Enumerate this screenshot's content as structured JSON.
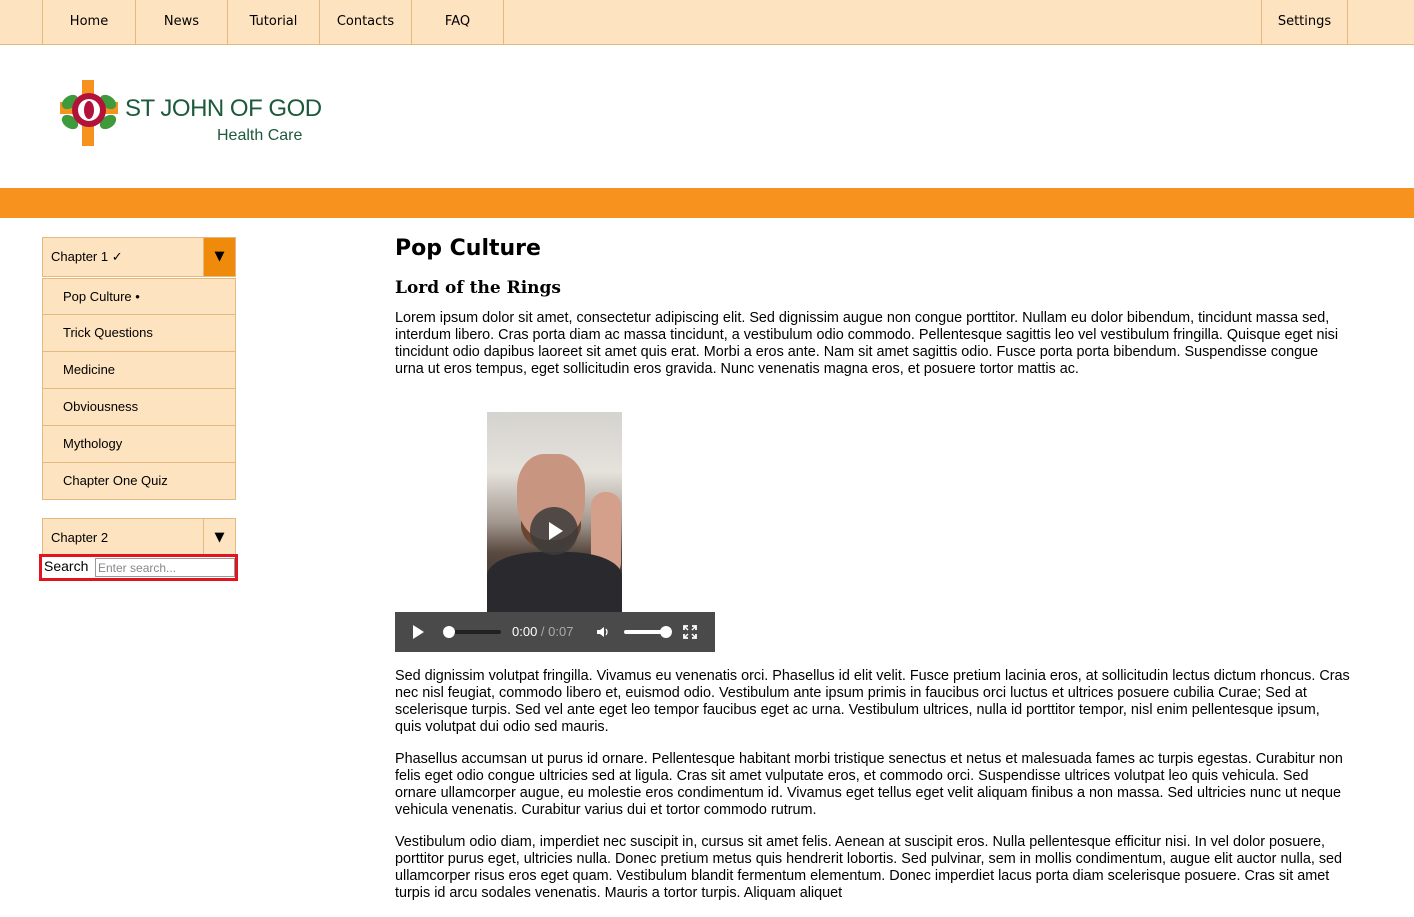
{
  "nav": {
    "home": "Home",
    "news": "News",
    "tutorial": "Tutorial",
    "contacts": "Contacts",
    "faq": "FAQ",
    "settings": "Settings"
  },
  "logo": {
    "line1": "ST JOHN OF GOD",
    "line2": "Health Care"
  },
  "colors": {
    "nav_bg": "#fde3bf",
    "accent_orange": "#f7921e",
    "toggle_active": "#f08a0b",
    "search_highlight": "#e0151f"
  },
  "sidebar": {
    "chapter1": {
      "label": "Chapter 1 ✓",
      "toggle": "▼"
    },
    "items": [
      {
        "label": "Pop Culture •"
      },
      {
        "label": "Trick Questions"
      },
      {
        "label": "Medicine"
      },
      {
        "label": "Obviousness"
      },
      {
        "label": "Mythology"
      },
      {
        "label": "Chapter One Quiz"
      }
    ],
    "chapter2": {
      "label": "Chapter 2",
      "toggle": "▼"
    },
    "search": {
      "label": "Search",
      "placeholder": "Enter search..."
    }
  },
  "main": {
    "title": "Pop Culture",
    "subtitle": "Lord of the Rings",
    "para1": "Lorem ipsum dolor sit amet, consectetur adipiscing elit. Sed dignissim augue non congue porttitor. Nullam eu dolor bibendum, tincidunt massa sed, interdum libero. Cras porta diam ac massa tincidunt, a vestibulum odio commodo. Pellentesque sagittis leo vel vestibulum fringilla. Quisque eget nisi tincidunt odio dapibus laoreet sit amet quis erat. Morbi a eros ante. Nam sit amet sagittis odio. Fusce porta porta bibendum. Suspendisse congue urna ut eros tempus, eget sollicitudin eros gravida. Nunc venenatis magna eros, et posuere tortor mattis ac.",
    "video": {
      "current": "0:00",
      "separator": " / ",
      "duration": "0:07"
    },
    "para2": "Sed dignissim volutpat fringilla. Vivamus eu venenatis orci. Phasellus id elit velit. Fusce pretium lacinia eros, at sollicitudin lectus dictum rhoncus. Cras nec nisl feugiat, commodo libero et, euismod odio. Vestibulum ante ipsum primis in faucibus orci luctus et ultrices posuere cubilia Curae; Sed at scelerisque turpis. Sed vel ante eget leo tempor faucibus eget ac urna. Vestibulum ultrices, nulla id porttitor tempor, nisl enim pellentesque ipsum, quis volutpat dui odio sed mauris.",
    "para3": "Phasellus accumsan ut purus id ornare. Pellentesque habitant morbi tristique senectus et netus et malesuada fames ac turpis egestas. Curabitur non felis eget odio congue ultricies sed at ligula. Cras sit amet vulputate eros, et commodo orci. Suspendisse ultrices volutpat leo quis vehicula. Sed ornare ullamcorper augue, eu molestie eros condimentum id. Vivamus eget tellus eget velit aliquam finibus a non massa. Sed ultricies nunc ut neque vehicula venenatis. Curabitur varius dui et tortor commodo rutrum.",
    "para4": "Vestibulum odio diam, imperdiet nec suscipit in, cursus sit amet felis. Aenean at suscipit eros. Nulla pellentesque efficitur nisi. In vel dolor posuere, porttitor purus eget, ultricies nulla. Donec pretium metus quis hendrerit lobortis. Sed pulvinar, sem in mollis condimentum, augue elit auctor nulla, sed ullamcorper risus eros eget quam. Vestibulum blandit fermentum elementum. Donec imperdiet lacus porta diam scelerisque posuere. Cras sit amet turpis id arcu sodales venenatis. Mauris a tortor turpis. Aliquam aliquet"
  }
}
